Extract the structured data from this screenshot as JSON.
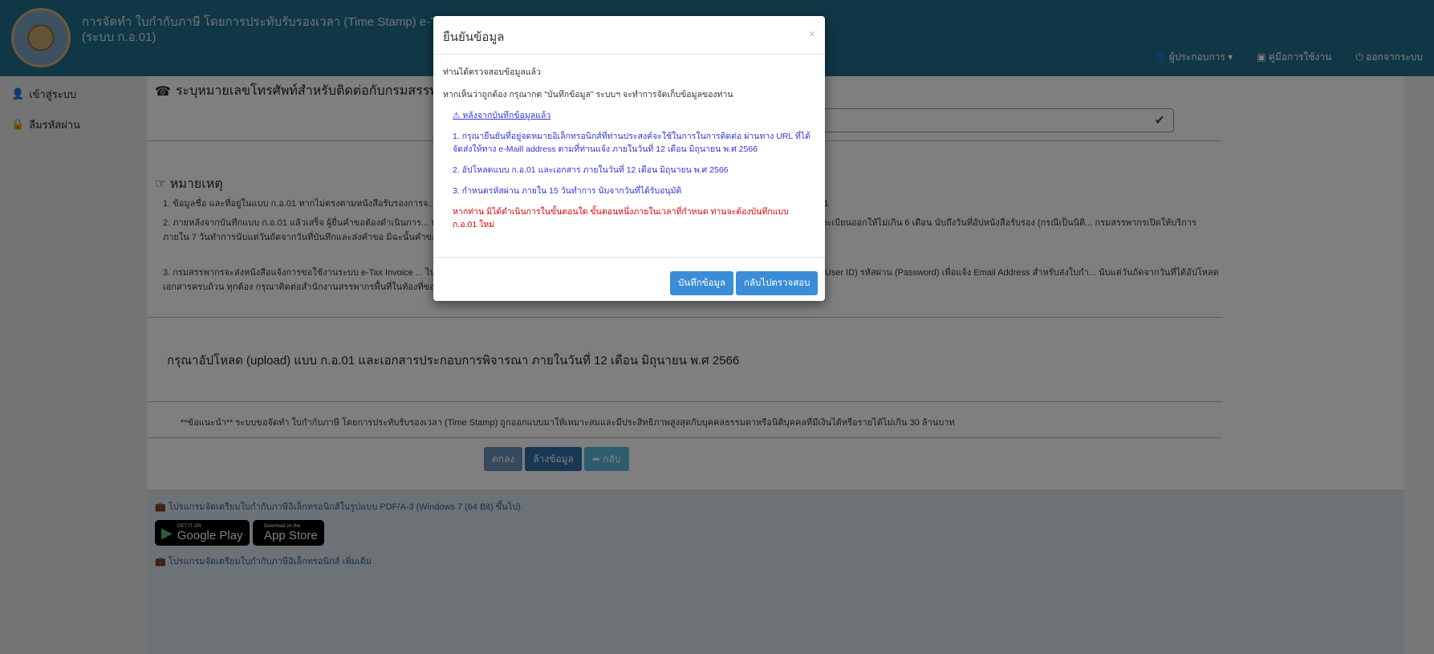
{
  "header": {
    "title_line1": "การจัดทำ ใบกำกับภาษี โดยการประทับรับรองเวลา (Time Stamp) e-Tax Invoice",
    "title_line2": "(ระบบ ก.อ.01)",
    "nav": [
      {
        "icon": "user-icon",
        "label": "ผู้ประกอบการ ▾"
      },
      {
        "icon": "book-icon",
        "label": "คู่มือการใช้งาน"
      },
      {
        "icon": "power-icon",
        "label": "ออกจากระบบ"
      }
    ]
  },
  "sidebar": {
    "items": [
      {
        "icon": "user-icon",
        "label": "เข้าสู่ระบบ"
      },
      {
        "icon": "lock-icon",
        "label": "ลืมรหัสผ่าน"
      }
    ]
  },
  "main": {
    "phone_section_title": "ระบุหมายเลขโทรศัพท์สำหรับติดต่อกับกรมสรรพากร",
    "phone_value": "",
    "notes_title": "หมายเหตุ",
    "notes": [
      "1. ข้อมูลชื่อ และที่อยู่ในแบบ ก.อ.01 หากไม่ตรงตามหนังสือรับรองการจ... จดทะเบียนภาษีมูลค่าเพิ่ม (ภ.พ.09) ณ สถานที่ได้จดทะเบียนภาษีมูลค่าเพิ่ม ก่อนดำเนินการยื่นแบบ ก.อ.01",
      "2. ภายหลังจากบันทึกแบบ ก.อ.01 แล้วเสร็จ ผู้ยื่นคำขอต้องดำเนินการ... ประทับตรา (ถ้ามี) พร้อมเอกสารประกอบการพิจารณา ได้แก่ หนังสือรับรองการจดทะเบียนนิติบุคคลที่นายทะเบียนออกให้ไม่เกิน 6 เดือน นับถึงวันที่อัปหนังสือรับรอง (กรณีเป็นนิติ... กรมสรรพากรเปิดให้บริการ ภายใน 7 วันทำการนับแต่วันถัดจากวันที่บันทึกและส่งคำขอ มิฉะนั้นคำขอของท่านจะถูกยกเลิกโดยมิต้องแจ้งให้ทราบล่วงหน้า",
      "3. กรมสรรพากรจะส่งหนังสือแจ้งการขอใช้งานระบบ e-Tax Invoice ... ไปกรอกในระบบภายใน 15 วันทำการนับแต่วันถัดจากวันที่ออกหนังสือแจ้ง เพื่อยืนยันตัวตนและรับรหัสผู้ใช้ (User ID) รหัสผ่าน (Password) เพื่อแจ้ง Email Address สำหรับส่งใบกำ... นับแต่วันถัดจากวันที่ได้อัปโหลดเอกสารครบถ้วน ทุกต้อง กรุณาติดต่อสำนักงานสรรพากรพื้นที่ในท้องที่ของท่าน"
    ],
    "upload_text": "กรุณาอัปโหลด (upload) แบบ ก.อ.01 และเอกสารประกอบการพิจารณา ภายในวันที่ 12 เดือน มิถุนายน พ.ศ 2566",
    "advice": "**ข้อแนะนำ** ระบบขอจัดทำ ใบกำกับภาษี โดยการประทับรับรองเวลา (Time Stamp) ถูกออกแบบมาให้เหมาะสมและมีประสิทธิภาพสูงสุดกับบุคคลธรรมดาหรือนิติบุคคลที่มีเงินได้หรือรายได้ไม่เกิน 30 ล้านบาท",
    "buttons": {
      "ok": "ตกลง",
      "clear": "ล้างข้อมูล",
      "back": "➦ กลับ"
    }
  },
  "footer": {
    "link1": "โปรแกรมจัดเตรียมใบกำกับภาษีอิเล็กทรอนิกส์ในรูปแบบ PDF/A-3 (Windows 7 (64 Bit) ขึ้นไป)",
    "google_small": "GET IT ON",
    "google_big": "Google Play",
    "apple_small": "Download on the",
    "apple_big": "App Store",
    "link2": "โปรแกรมจัดเตรียมใบกำกับภาษีอิเล็กทรอนิกส์ เพิ่มเติม"
  },
  "modal": {
    "title": "ยืนยันข้อมูล",
    "close": "×",
    "line1": "ท่านได้ตรวจสอบข้อมูลแล้ว",
    "line2": "หากเห็นว่าถูกต้อง กรุณากด \"บันทึกข้อมูล\" ระบบฯ จะทำการจัดเก็บข้อมูลของท่าน",
    "warning_link": "⚠ หลังจากบันทึกข้อมูลแล้ว",
    "step1": "1. กรุณายืนยันที่อยู่จดหมายอิเล็กทรอนิกส์ที่ท่านประสงค์จะใช้ในการในการติดต่อ ผ่านทาง URL ที่ได้จัดส่งให้ทาง e-Maill address ตามที่ท่านแจ้ง ภายในวันที่ 12 เดือน มิถุนายน พ.ศ 2566",
    "step2": "2. อัปโหลดแบบ ก.อ.01 และเอกสาร ภายในวันที่ 12 เดือน มิถุนายน พ.ศ 2566",
    "step3": "3. กำหนดรหัสผ่าน ภายใน 15 วันทำการ นับจากวันที่ได้รับอนุมัติ",
    "red_warning": "หากท่าน มิได้ดำเนินการในขั้นตอนใด ขั้นตอนหนึ่งภายในเวลาที่กำหนด ท่านจะต้องบันทึกแบบ ก.อ.01 ใหม่",
    "save_label": "บันทึกข้อมูล",
    "review_label": "กลับไปตรวจสอบ"
  }
}
